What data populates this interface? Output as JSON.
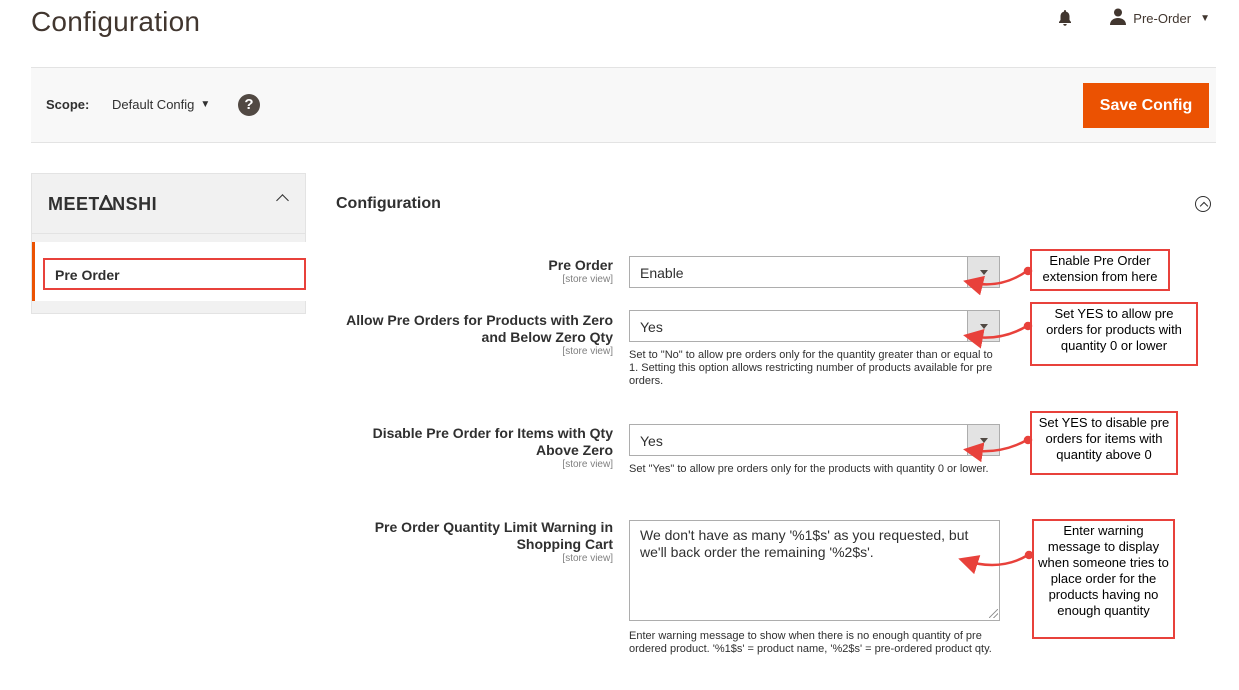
{
  "header": {
    "title": "Configuration",
    "user_label": "Pre-Order"
  },
  "scope": {
    "label": "Scope:",
    "value": "Default Config",
    "save_label": "Save Config"
  },
  "sidebar": {
    "brand": "MEETANSHI",
    "items": [
      {
        "label": "Pre Order"
      }
    ]
  },
  "section": {
    "title": "Configuration"
  },
  "fields": [
    {
      "label": "Pre Order",
      "scope": "[store view]",
      "value": "Enable",
      "note": ""
    },
    {
      "label": "Allow Pre Orders for Products with Zero and Below Zero Qty",
      "scope": "[store view]",
      "value": "Yes",
      "note": "Set to \"No\" to allow pre orders only for the quantity greater than or equal to 1. Setting this option allows restricting number of products available for pre orders."
    },
    {
      "label": "Disable Pre Order for Items with Qty Above Zero",
      "scope": "[store view]",
      "value": "Yes",
      "note": "Set \"Yes\" to allow pre orders only for the products with quantity 0 or lower."
    },
    {
      "label": "Pre Order Quantity Limit Warning in Shopping Cart",
      "scope": "[store view]",
      "value": "We don't have as many '%1$s' as you requested, but we'll back order the remaining '%2$s'.",
      "note": "Enter warning message to show when there is no enough quantity of pre ordered product. '%1$s' = product name, '%2$s' = pre-ordered product qty."
    }
  ],
  "callouts": [
    "Enable Pre Order extension from here",
    "Set YES to allow pre orders for products with quantity 0 or lower",
    "Set YES to disable pre orders for items with quantity above 0",
    "Enter warning message to display when someone tries to place order for the products having no enough quantity"
  ],
  "colors": {
    "accent": "#eb5202",
    "annotation": "#e8413b"
  }
}
